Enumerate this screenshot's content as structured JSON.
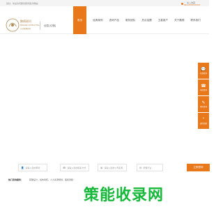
{
  "topbar": {
    "welcome": "您好，欢迎访问鹏德顾问官方网站！",
    "favorite": "加入收藏",
    "phone": "021-XXXX-XXXX"
  },
  "header": {
    "logo_cn": "鹏德顾问",
    "logo_en": "PENGDE CONSULTING",
    "logo_sub": "企业管理咨询",
    "city": "全国 [切换]"
  },
  "nav": {
    "items": [
      "首页",
      "经典案例",
      "咨询产品",
      "服务团队",
      "热点话题",
      "五星客户",
      "关于鹏德",
      "联系我们"
    ]
  },
  "side_tools": [
    {
      "icon": "chat-icon",
      "glyph": "💬",
      "label": "在线咨询"
    },
    {
      "icon": "phone-icon",
      "glyph": "☎",
      "label": "电话咨询"
    },
    {
      "icon": "edit-icon",
      "glyph": "✎",
      "label": "预约咨询"
    },
    {
      "icon": "top-icon",
      "glyph": "⌃",
      "label": "返回顶部"
    }
  ],
  "form": {
    "name_placeholder": "请输入您的称呼",
    "phone_placeholder": "请输入您的联系方式",
    "company_placeholder": "请输入您的公司名称",
    "industry_placeholder": "所属行业",
    "submit": "立即咨询"
  },
  "services": {
    "label": "热门咨询服务：",
    "text": "薪酬设计，绩效考核，人力资源规划，股权激励…"
  },
  "watermark": "策能收录网"
}
